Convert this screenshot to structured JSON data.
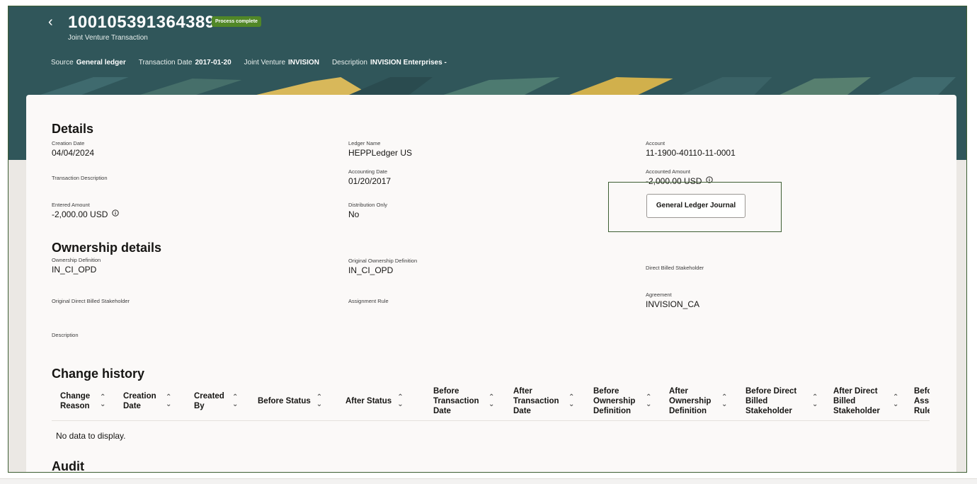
{
  "header": {
    "title": "100105391364389",
    "status_badge": "Process complete",
    "subtitle": "Joint Venture Transaction",
    "meta": [
      {
        "key": "Source",
        "value": "General ledger"
      },
      {
        "key": "Transaction Date",
        "value": "2017-01-20"
      },
      {
        "key": "Joint Venture",
        "value": "INVISION"
      },
      {
        "key": "Description",
        "value": "INVISION Enterprises -"
      }
    ]
  },
  "details": {
    "title": "Details",
    "creation_date": {
      "label": "Creation Date",
      "value": "04/04/2024"
    },
    "ledger_name": {
      "label": "Ledger Name",
      "value": "HEPPLedger US"
    },
    "account": {
      "label": "Account",
      "value": "11-1900-40110-11-0001"
    },
    "transaction_description": {
      "label": "Transaction Description"
    },
    "accounting_date": {
      "label": "Accounting Date",
      "value": "01/20/2017"
    },
    "accounted_amount": {
      "label": "Accounted Amount",
      "value": "-2,000.00 USD"
    },
    "entered_amount": {
      "label": "Entered Amount",
      "value": "-2,000.00 USD"
    },
    "distribution_only": {
      "label": "Distribution Only",
      "value": "No"
    },
    "gl_journal_button": "General Ledger Journal"
  },
  "ownership": {
    "title": "Ownership details",
    "ownership_definition": {
      "label": "Ownership Definition",
      "value": "IN_CI_OPD"
    },
    "original_ownership_definition": {
      "label": "Original Ownership Definition",
      "value": "IN_CI_OPD"
    },
    "direct_billed_stakeholder": {
      "label": "Direct Billed Stakeholder"
    },
    "original_direct_billed_stakeholder": {
      "label": "Original Direct Billed Stakeholder"
    },
    "assignment_rule": {
      "label": "Assignment Rule"
    },
    "agreement": {
      "label": "Agreement",
      "value": "INVISION_CA"
    },
    "description": {
      "label": "Description"
    }
  },
  "change_history": {
    "title": "Change history",
    "columns": [
      "Change Reason",
      "Creation Date",
      "Created By",
      "Before Status",
      "After Status",
      "Before Transaction Date",
      "After Transaction Date",
      "Before Ownership Definition",
      "After Ownership Definition",
      "Before Direct Billed Stakeholder",
      "After Direct Billed Stakeholder",
      "Before Assignment Rule"
    ],
    "empty_text": "No data to display."
  },
  "audit": {
    "title": "Audit"
  },
  "colors": {
    "header_bg": "#30565a",
    "badge_bg": "#518727",
    "highlight_border": "#3d5e33"
  }
}
